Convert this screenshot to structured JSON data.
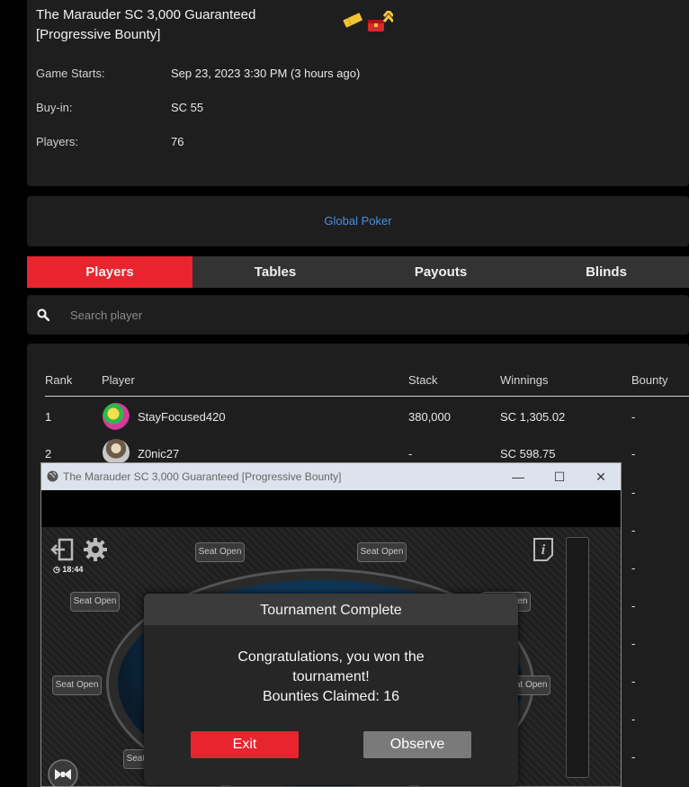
{
  "tournament": {
    "title": "The Marauder SC 3,000 Guaranteed [Progressive Bounty]",
    "icons": [
      "ticket-icon",
      "bounty-chest-icon"
    ],
    "details": [
      {
        "label": "Game Starts:",
        "value": "Sep 23, 2023 3:30 PM (3 hours ago)"
      },
      {
        "label": "Buy-in:",
        "value": "SC 55"
      },
      {
        "label": "Players:",
        "value": "76"
      }
    ]
  },
  "site_link": "Global Poker",
  "tabs": [
    {
      "label": "Players",
      "active": true
    },
    {
      "label": "Tables",
      "active": false
    },
    {
      "label": "Payouts",
      "active": false
    },
    {
      "label": "Blinds",
      "active": false
    }
  ],
  "search": {
    "placeholder": "Search player",
    "value": ""
  },
  "players_table": {
    "headers": [
      "Rank",
      "Player",
      "Stack",
      "Winnings",
      "Bounty"
    ],
    "rows": [
      {
        "rank": "1",
        "player": "StayFocused420",
        "stack": "380,000",
        "winnings": "SC 1,305.02",
        "bounty": "-"
      },
      {
        "rank": "2",
        "player": "Z0nic27",
        "stack": "-",
        "winnings": "SC 598.75",
        "bounty": "-"
      }
    ],
    "bounty_column_dashes": [
      "-",
      "-",
      "-",
      "-",
      "-",
      "-",
      "-",
      "-"
    ]
  },
  "client_window": {
    "title": "The Marauder SC 3,000 Guaranteed [Progressive Bounty]",
    "controls": {
      "minimize": "—",
      "maximize": "☐",
      "close": "✕"
    },
    "timer": "18:44",
    "seat_label": "Seat Open"
  },
  "dialog": {
    "title": "Tournament Complete",
    "message_line1": "Congratulations, you won the",
    "message_line2": "tournament!",
    "message_line3": "Bounties Claimed: 16",
    "exit_label": "Exit",
    "observe_label": "Observe"
  },
  "colors": {
    "accent_red": "#e8242f",
    "link_blue": "#4a8fe0",
    "table_felt": "#1d4f7a"
  }
}
